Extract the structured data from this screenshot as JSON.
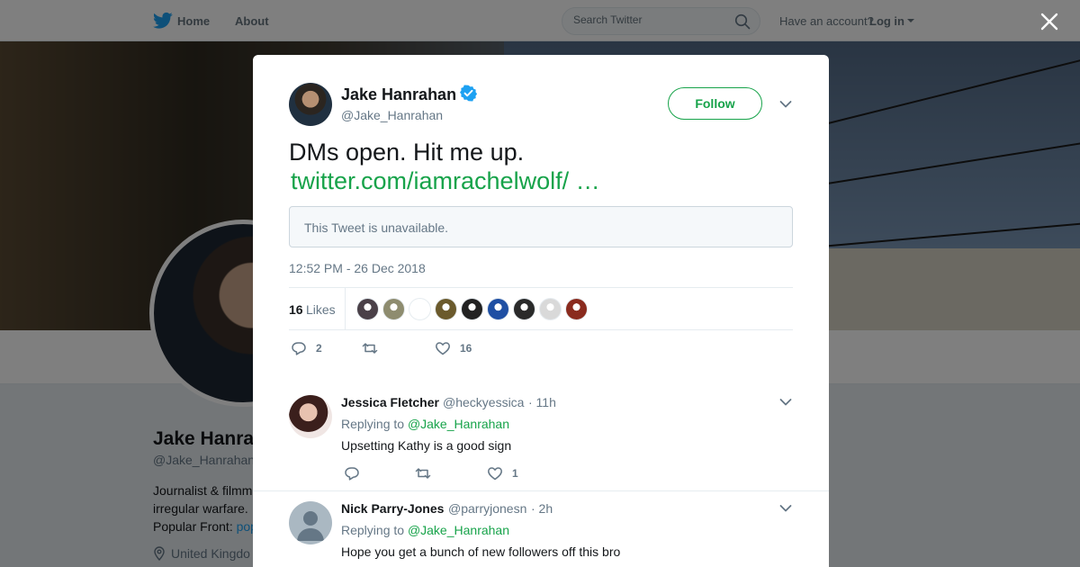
{
  "nav": {
    "home_label": "Home",
    "about_label": "About",
    "search_placeholder": "Search Twitter",
    "have_account": "Have an account?",
    "login_label": "Log in"
  },
  "profile_bg": {
    "name": "Jake Hanrahan",
    "handle": "@Jake_Hanrahan",
    "bio_line1": "Journalist & filmm",
    "bio_line2": "irregular warfare. .",
    "bio_line3_prefix": "Popular Front: ",
    "bio_line3_link": "pop",
    "location": "United Kingdo"
  },
  "tweet": {
    "author_name": "Jake Hanrahan",
    "author_handle": "@Jake_Hanrahan",
    "verified": true,
    "follow_label": "Follow",
    "text": "DMs open. Hit me up.",
    "link": "twitter.com/iamrachelwolf/ …",
    "quoted_unavailable": "This Tweet is unavailable.",
    "timestamp": "12:52 PM - 26 Dec 2018",
    "likes_count": "16",
    "likes_label": "Likes",
    "likers": [
      "#4a4048",
      "#8e8c6f",
      "#ffffff",
      "#6b5a2c",
      "#222222",
      "#1f4fa3",
      "#2a2a2a",
      "#d9d9d9",
      "#8a2b1e"
    ],
    "replies_count": "2",
    "retweets_count": "",
    "likes_action_count": "16"
  },
  "replies": [
    {
      "name": "Jessica Fletcher",
      "handle": "@heckyessica",
      "time": "· 11h",
      "replying_prefix": "Replying to ",
      "replying_to": "@Jake_Hanrahan",
      "text": "Upsetting Kathy is a good sign",
      "reply_count": "",
      "retweet_count": "",
      "like_count": "1"
    },
    {
      "name": "Nick Parry-Jones",
      "handle": "@parryjonesn",
      "time": "· 2h",
      "replying_prefix": "Replying to ",
      "replying_to": "@Jake_Hanrahan",
      "text": "Hope you get a bunch of new followers off this bro"
    }
  ],
  "colors": {
    "accent": "#17a34a",
    "secondary_text": "#657786",
    "verified": "#1da1f2",
    "twitter_blue": "#1da1f2"
  }
}
